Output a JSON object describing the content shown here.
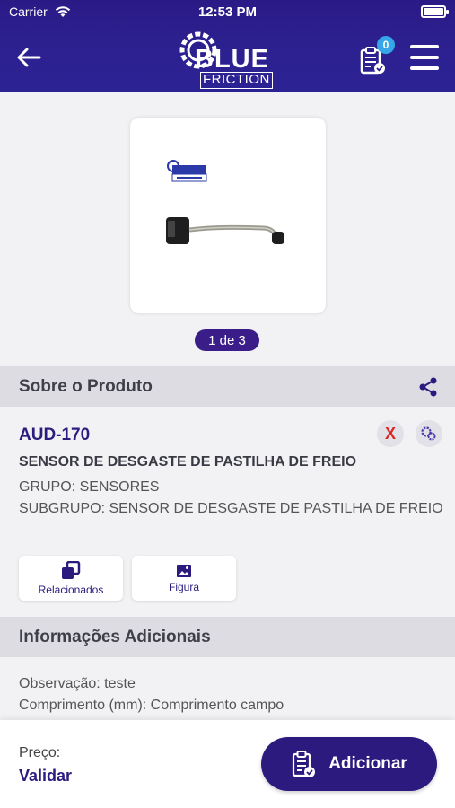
{
  "status_bar": {
    "carrier": "Carrier",
    "time": "12:53 PM"
  },
  "header": {
    "logo_top": "BLUE",
    "logo_bottom": "FRICTION",
    "cart_count": "0"
  },
  "gallery": {
    "pager": "1 de 3"
  },
  "about": {
    "section_title": "Sobre o Produto",
    "code": "AUD-170",
    "name": "SENSOR DE DESGASTE DE PASTILHA DE FREIO",
    "grupo": "GRUPO: SENSORES",
    "subgrupo": "SUBGRUPO: SENSOR DE DESGASTE DE PASTILHA DE FREIO",
    "remove_label": "X",
    "related_label": "Relacionados",
    "figure_label": "Figura"
  },
  "additional": {
    "section_title": "Informações Adicionais",
    "observacao": "Observação: teste",
    "comprimento": "Comprimento (mm): Comprimento campo"
  },
  "footer": {
    "price_label": "Preço:",
    "price_value": "Validar",
    "add_label": "Adicionar"
  },
  "colors": {
    "primary": "#2c1a7e",
    "badge": "#35a7e8",
    "danger": "#e02525",
    "section_bg": "#dcdce2"
  }
}
